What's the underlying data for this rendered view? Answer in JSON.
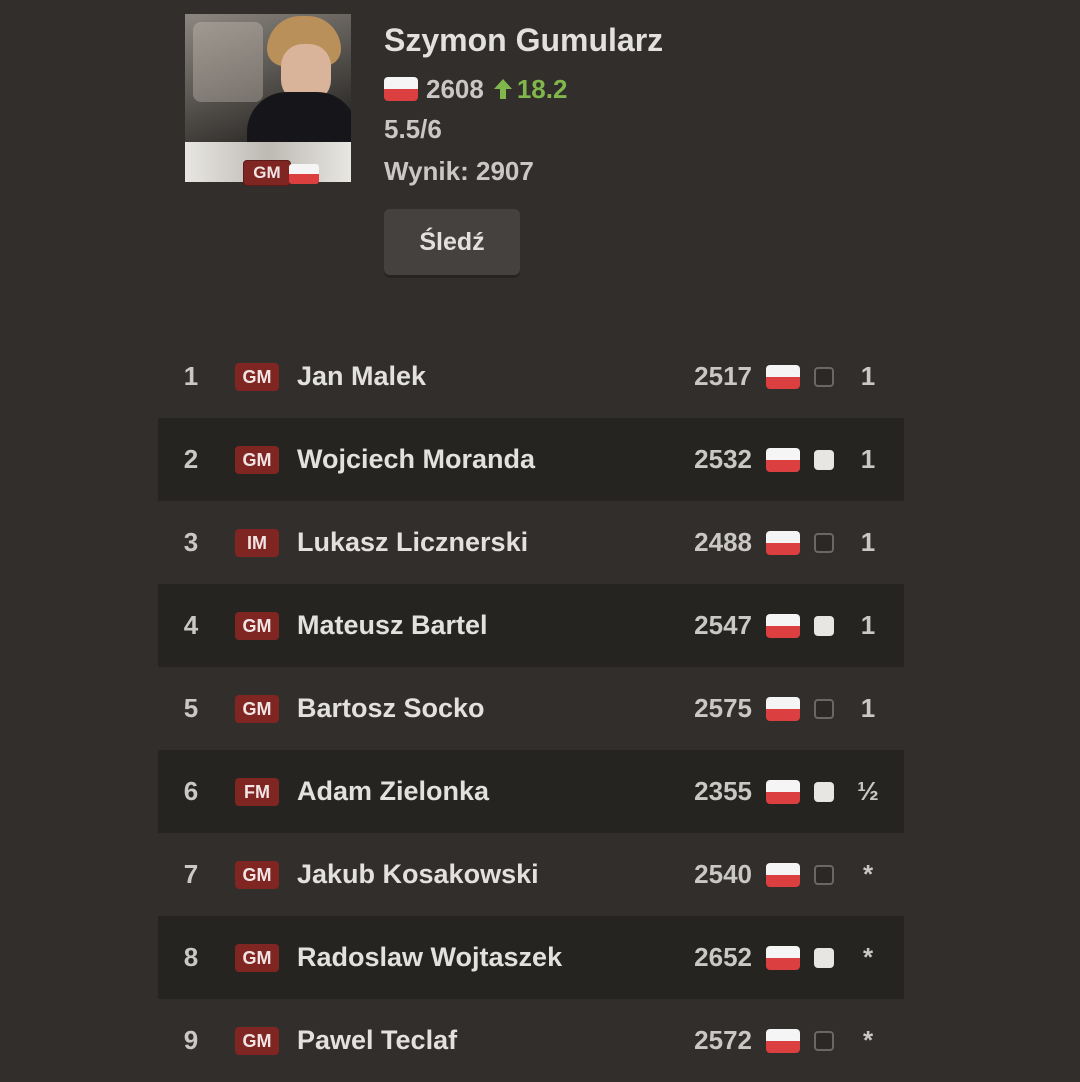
{
  "player": {
    "name": "Szymon Gumularz",
    "title": "GM",
    "rating": "2608",
    "rating_change": "18.2",
    "score": "5.5/6",
    "performance": "Wynik: 2907",
    "follow_label": "Śledź"
  },
  "colors": {
    "background": "#312e2b",
    "row_alt": "#262421",
    "title_badge": "#7f2522",
    "positive": "#81b64c",
    "flag_red": "#dc3f3f"
  },
  "opponents": [
    {
      "round": "1",
      "title": "GM",
      "name": "Jan Malek",
      "rating": "2517",
      "flag": "poland-flag",
      "color": "black",
      "result": "1"
    },
    {
      "round": "2",
      "title": "GM",
      "name": "Wojciech Moranda",
      "rating": "2532",
      "flag": "poland-flag",
      "color": "white",
      "result": "1"
    },
    {
      "round": "3",
      "title": "IM",
      "name": "Lukasz Licznerski",
      "rating": "2488",
      "flag": "poland-flag",
      "color": "black",
      "result": "1"
    },
    {
      "round": "4",
      "title": "GM",
      "name": "Mateusz Bartel",
      "rating": "2547",
      "flag": "poland-flag",
      "color": "white",
      "result": "1"
    },
    {
      "round": "5",
      "title": "GM",
      "name": "Bartosz Socko",
      "rating": "2575",
      "flag": "poland-flag",
      "color": "black",
      "result": "1"
    },
    {
      "round": "6",
      "title": "FM",
      "name": "Adam Zielonka",
      "rating": "2355",
      "flag": "poland-flag",
      "color": "white",
      "result": "½"
    },
    {
      "round": "7",
      "title": "GM",
      "name": "Jakub Kosakowski",
      "rating": "2540",
      "flag": "poland-flag",
      "color": "black",
      "result": "*"
    },
    {
      "round": "8",
      "title": "GM",
      "name": "Radoslaw Wojtaszek",
      "rating": "2652",
      "flag": "poland-flag",
      "color": "white",
      "result": "*"
    },
    {
      "round": "9",
      "title": "GM",
      "name": "Pawel Teclaf",
      "rating": "2572",
      "flag": "poland-flag",
      "color": "black",
      "result": "*"
    }
  ]
}
